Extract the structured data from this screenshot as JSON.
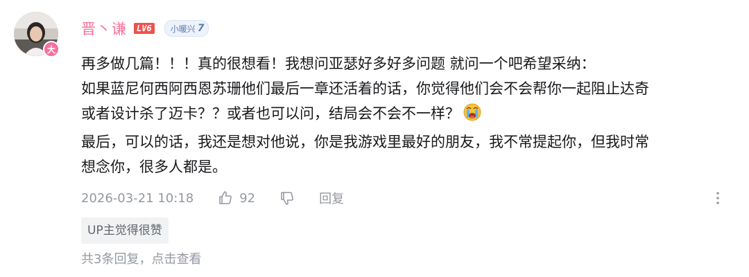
{
  "comment": {
    "user": {
      "name": "晋丶谦",
      "level": "LV6",
      "fan_badge": {
        "name": "小暖兴",
        "level": "7"
      },
      "avatar_badge": "大"
    },
    "content_lines": [
      "再多做几篇！！！真的很想看！我想问亚瑟好多好多问题 就问一个吧希望采纳：",
      "如果蓝尼何西阿西恩苏珊他们最后一章还活着的话，你觉得他们会不会帮你一起阻止达奇",
      "或者设计杀了迈卡？？或者也可以问，结局会不会不一样？",
      "最后，可以的话，我还是想对他说，你是我游戏里最好的朋友，我不常提起你，但我时常",
      "想念你，很多人都是。"
    ],
    "timestamp": "2026-03-21 10:18",
    "like_count": "92",
    "reply_label": "回复",
    "up_tag": "UP主觉得很赞",
    "view_replies": "共3条回复，点击查看"
  },
  "icons": {
    "like": "thumbs-up-icon",
    "dislike": "thumbs-down-icon",
    "more": "more-vertical-icon",
    "emoji": "crying-emoji-icon"
  },
  "colors": {
    "username": "#fb7299",
    "level_badge": "#f0524e",
    "meta_text": "#9499a0",
    "body_text": "#18191c"
  }
}
